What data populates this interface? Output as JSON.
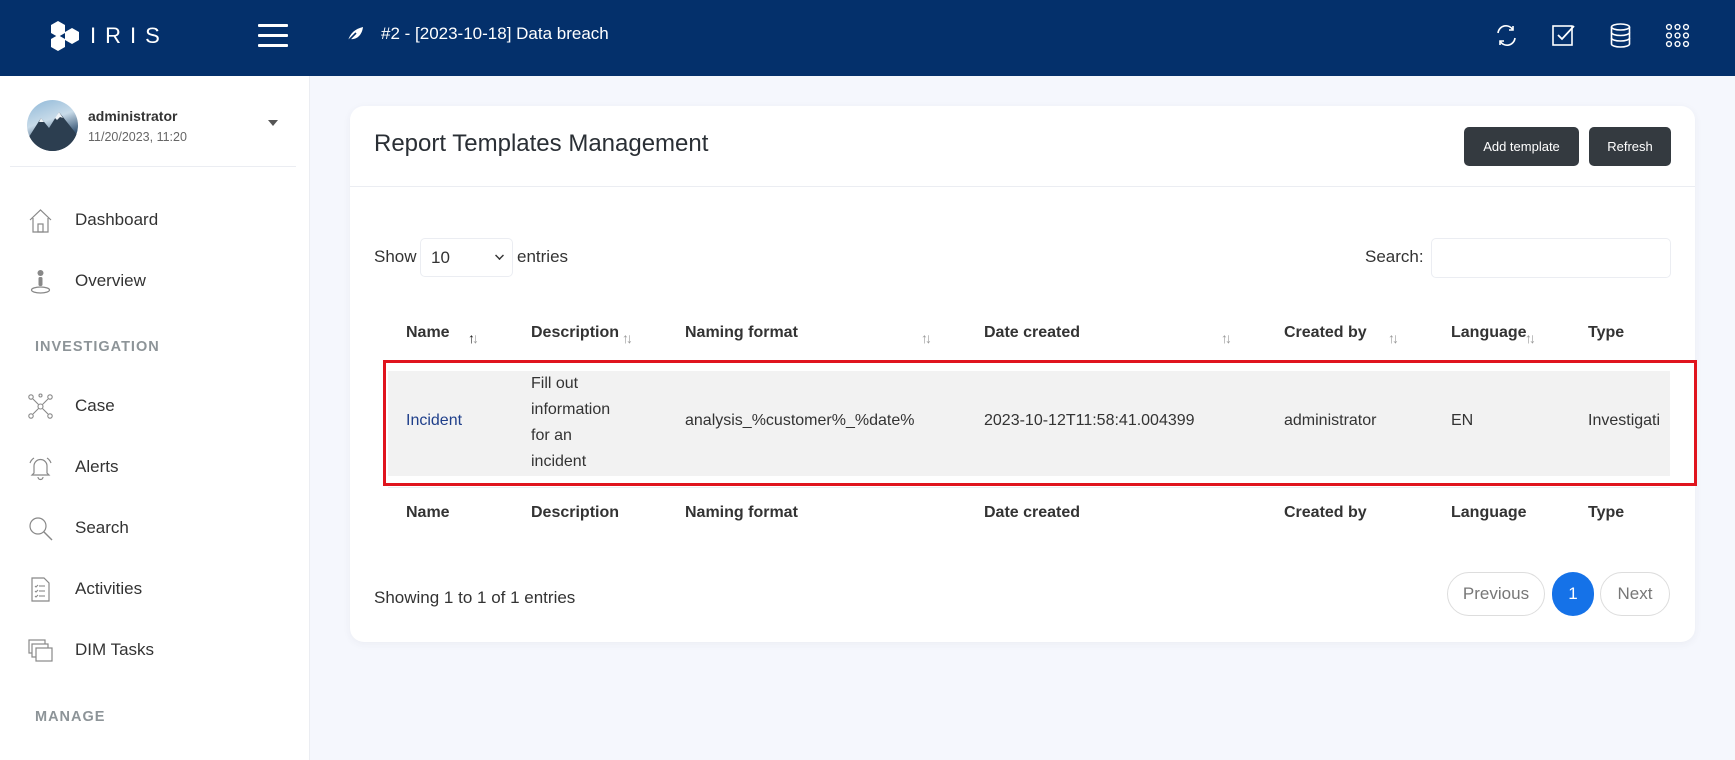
{
  "topbar": {
    "logo_text": "IRIS",
    "case_title": "#2 - [2023-10-18] Data breach",
    "icons": [
      "sync-icon",
      "checkbox-icon",
      "database-icon",
      "apps-grid-icon"
    ]
  },
  "user": {
    "name": "administrator",
    "datetime": "11/20/2023, 11:20"
  },
  "sidebar": {
    "items": [
      {
        "label": "Dashboard",
        "icon": "home-icon"
      },
      {
        "label": "Overview",
        "icon": "overview-icon"
      }
    ],
    "investigation_label": "INVESTIGATION",
    "investigation_items": [
      {
        "label": "Case",
        "icon": "case-icon"
      },
      {
        "label": "Alerts",
        "icon": "bell-icon"
      },
      {
        "label": "Search",
        "icon": "search-icon"
      },
      {
        "label": "Activities",
        "icon": "activities-icon"
      },
      {
        "label": "DIM Tasks",
        "icon": "tasks-icon"
      }
    ],
    "manage_label": "MANAGE"
  },
  "card": {
    "title": "Report Templates Management",
    "add_template_label": "Add template",
    "refresh_label": "Refresh"
  },
  "table_controls": {
    "show_label": "Show",
    "page_length": "10",
    "entries_label": "entries",
    "search_label": "Search:",
    "search_value": ""
  },
  "table": {
    "columns": [
      "Name",
      "Description",
      "Naming format",
      "Date created",
      "Created by",
      "Language",
      "Type"
    ],
    "rows": [
      {
        "name": "Incident",
        "description": [
          "Fill out",
          "information",
          "for an",
          "incident"
        ],
        "naming_format": "analysis_%customer%_%date%",
        "date_created": "2023-10-12T11:58:41.004399",
        "created_by": "administrator",
        "language": "EN",
        "type": "Investigati"
      }
    ]
  },
  "footer": {
    "info": "Showing 1 to 1 of 1 entries",
    "previous_label": "Previous",
    "current_page": "1",
    "next_label": "Next"
  },
  "colors": {
    "topbar": "#04306b",
    "highlight": "#e0141e",
    "pager_active": "#1572e8",
    "dark_button": "#343a40"
  }
}
